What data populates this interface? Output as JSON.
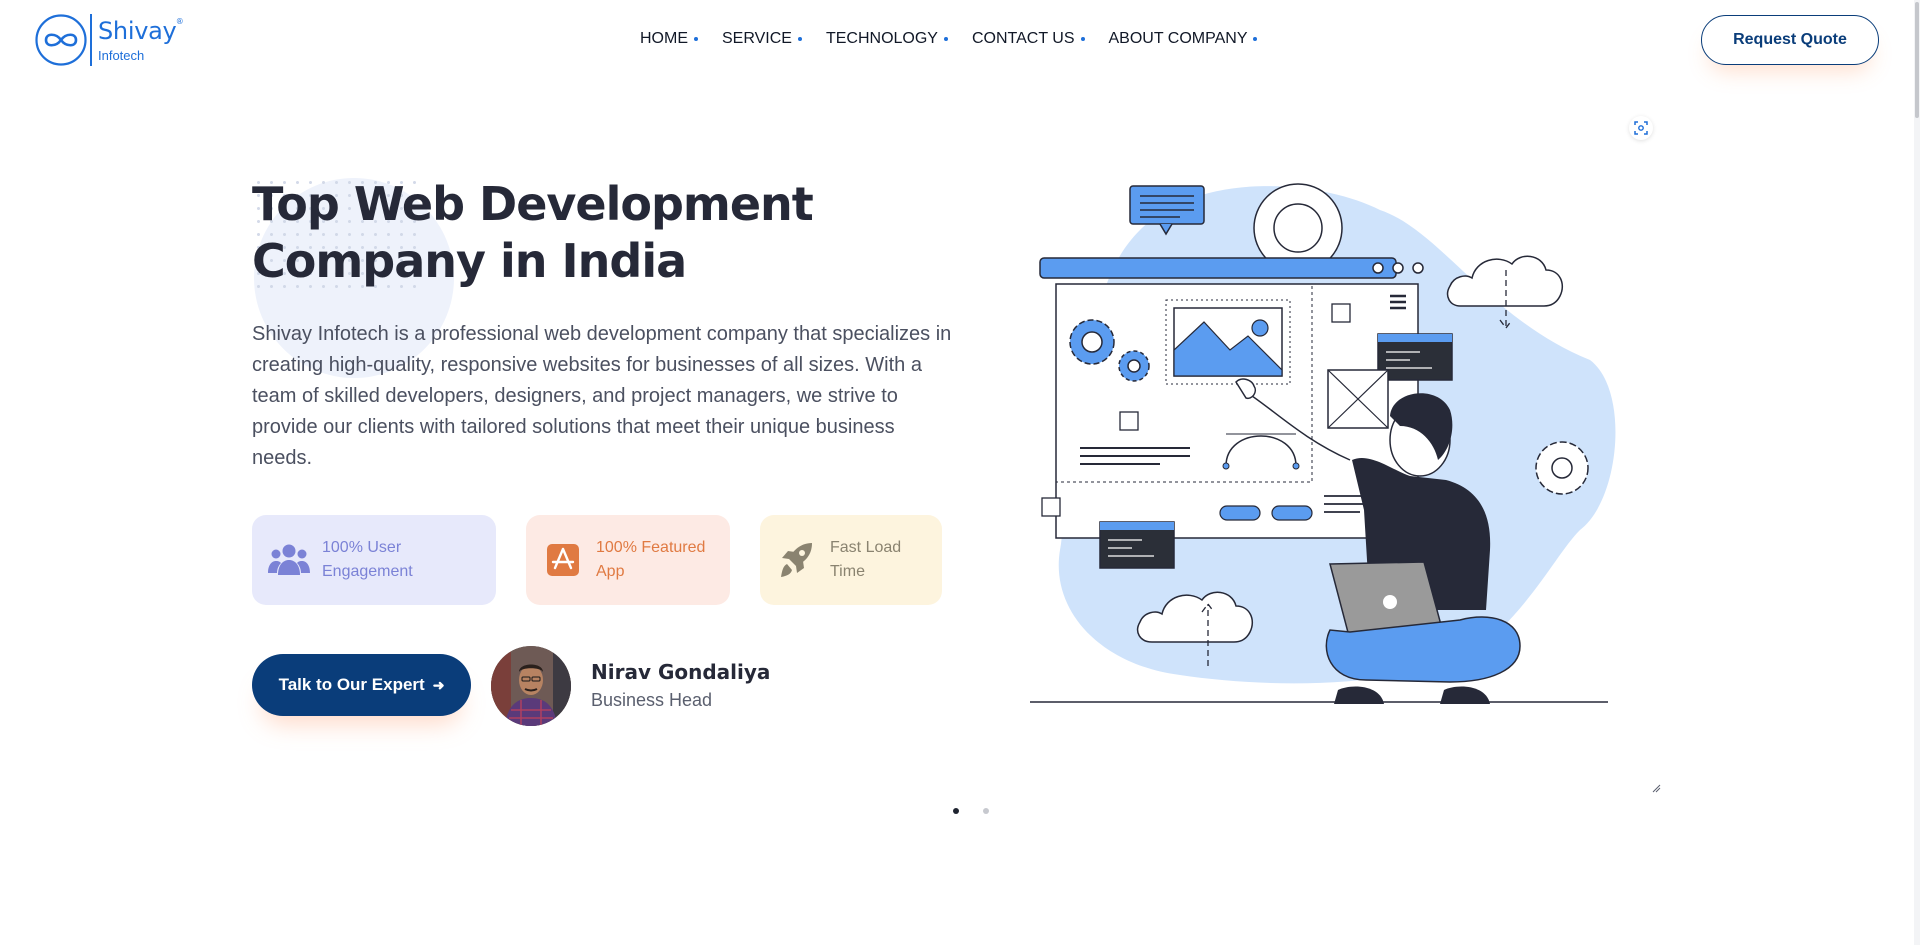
{
  "brand": {
    "name": "Shivay",
    "trademark": "®",
    "subtitle": "Infotech",
    "color": "#1e6fd9"
  },
  "nav": {
    "items": [
      {
        "label": "HOME"
      },
      {
        "label": "SERVICE"
      },
      {
        "label": "TECHNOLOGY"
      },
      {
        "label": "CONTACT US"
      },
      {
        "label": "ABOUT COMPANY"
      }
    ],
    "cta_label": "Request Quote"
  },
  "hero": {
    "title_line1": "Top Web Development",
    "title_line2": "Company in India",
    "description": "Shivay Infotech is a professional web development company that specializes in creating high-quality, responsive websites for businesses of all sizes. With a team of skilled developers, designers, and project managers, we strive to provide our clients with tailored solutions that meet their unique business needs.",
    "features": [
      {
        "line1": "100% User",
        "line2": "Engagement",
        "icon": "users-icon",
        "color": "#7b82d6"
      },
      {
        "line1": "100% Featured",
        "line2": "App",
        "icon": "app-store-icon",
        "color": "#e07a42"
      },
      {
        "line1": "Fast Load",
        "line2": "Time",
        "icon": "rocket-icon",
        "color": "#8a8370"
      }
    ],
    "cta_label": "Talk to Our Expert",
    "contact_name": "Nirav Gondaliya",
    "contact_role": "Business Head"
  },
  "carousel": {
    "slides": 2,
    "active": 1
  },
  "colors": {
    "primary_dark": "#0a3d7a",
    "illustration_blue": "#5b9cf0",
    "illustration_light": "#cfe3fb",
    "ink": "#262938"
  }
}
